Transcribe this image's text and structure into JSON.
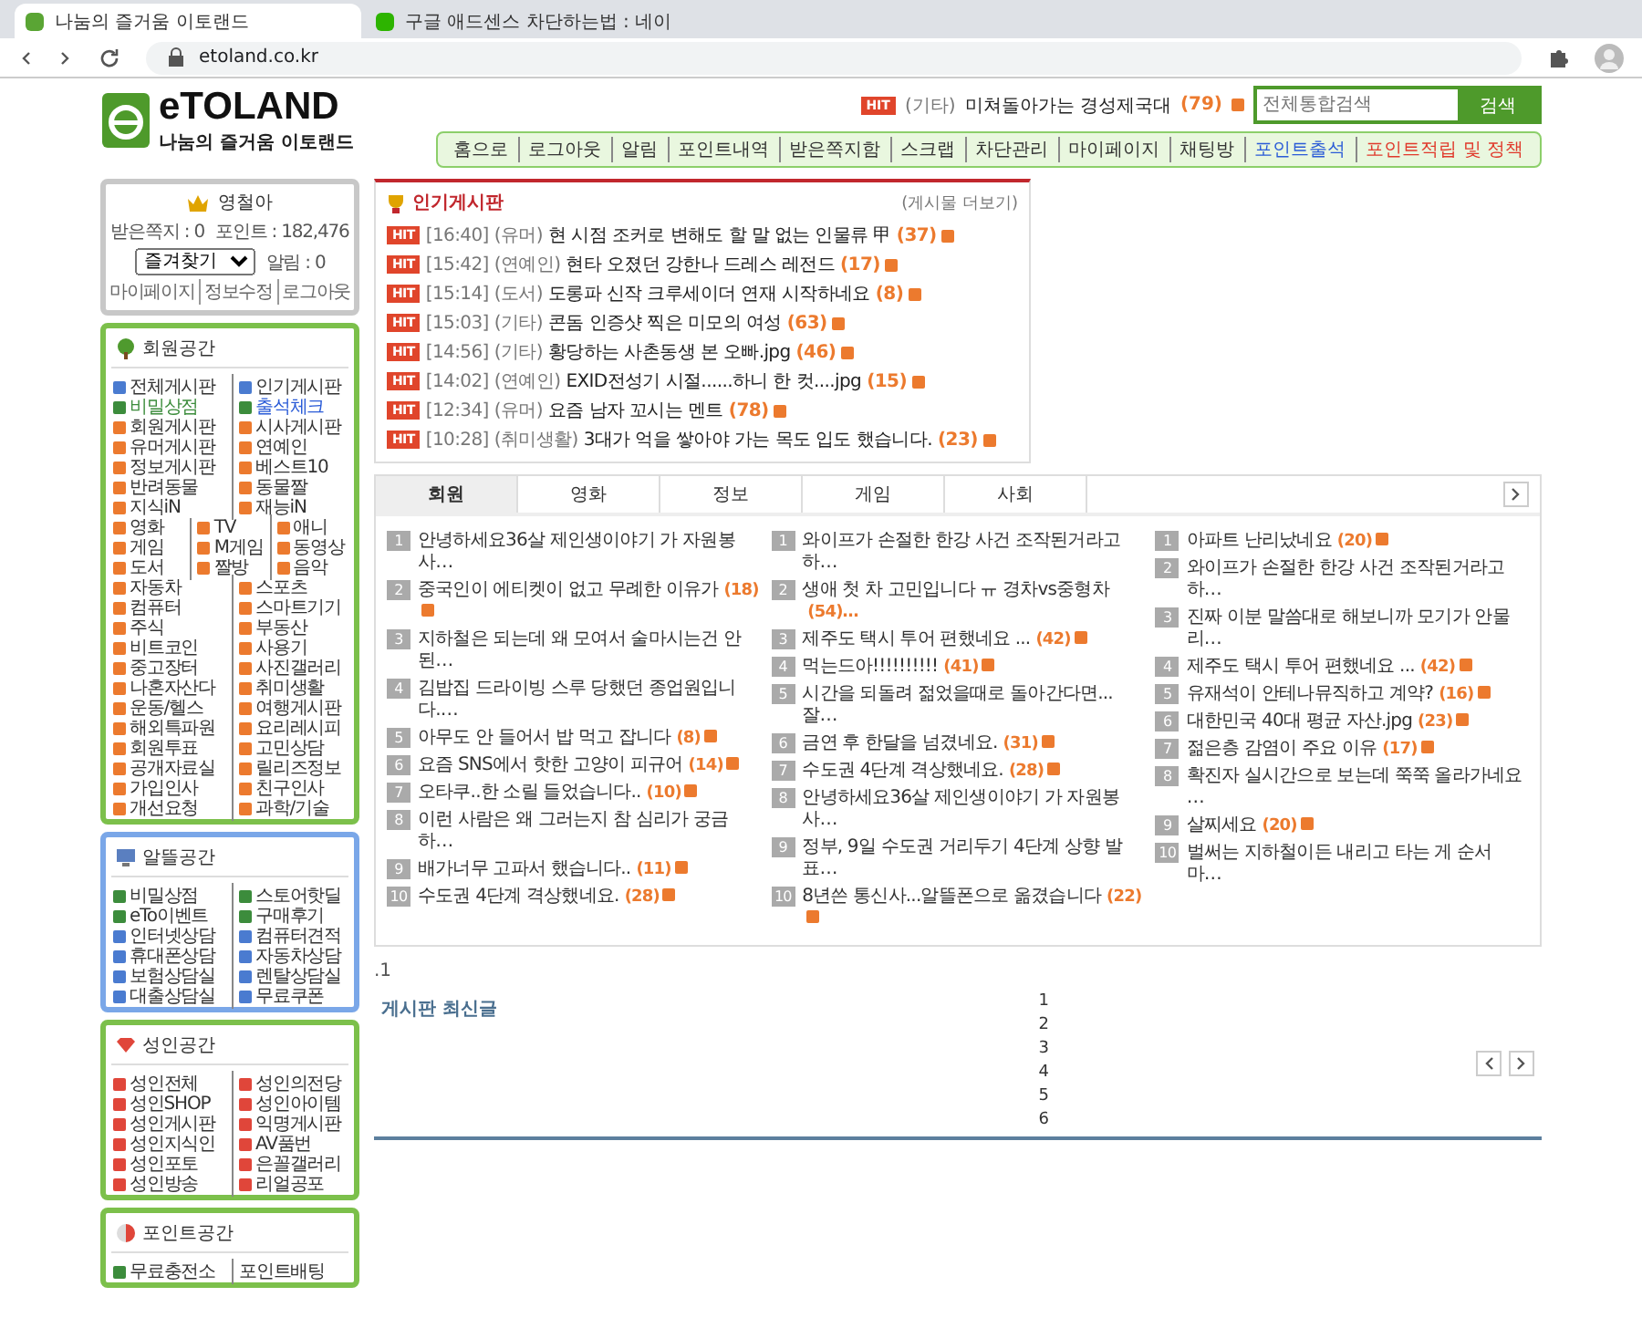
{
  "browser": {
    "tabs": [
      {
        "title": "나눔의 즐거움 이토랜드",
        "selected": true
      },
      {
        "title": "구글 애드센스 차단하는법 : 네이",
        "selected": false
      }
    ],
    "url": "etoland.co.kr"
  },
  "header": {
    "logo": {
      "name": "eTOLAND",
      "tagline": "나눔의 즐거움 이토랜드"
    },
    "ticker": {
      "badge": "HIT",
      "category": "(기타)",
      "title": "미쳐돌아가는 경성제국대",
      "count": "(79)"
    },
    "search": {
      "placeholder": "전체통합검색",
      "button": "검색"
    },
    "nav": [
      {
        "label": "홈으로",
        "color": "#333333"
      },
      {
        "label": "로그아웃",
        "color": "#333333"
      },
      {
        "label": "알림",
        "color": "#333333"
      },
      {
        "label": "포인트내역",
        "color": "#333333"
      },
      {
        "label": "받은쪽지함",
        "color": "#333333"
      },
      {
        "label": "스크랩",
        "color": "#333333"
      },
      {
        "label": "차단관리",
        "color": "#333333"
      },
      {
        "label": "마이페이지",
        "color": "#333333"
      },
      {
        "label": "채팅방",
        "color": "#333333"
      },
      {
        "label": "포인트출석",
        "color": "#2a5bd7"
      },
      {
        "label": "포인트적립 및 정책",
        "color": "#e0392b"
      }
    ]
  },
  "user_box": {
    "nickname": "영철아",
    "messages": "받은쪽지 : 0",
    "points": "포인트 : 182,476",
    "select": "즐겨찾기",
    "alarm": "알림 : 0",
    "links": [
      "마이페이지",
      "정보수정",
      "로그아웃"
    ]
  },
  "sidebar": {
    "sections": [
      {
        "title": "회원공간",
        "kind": "tree",
        "color": "#7cc04b",
        "rows": [
          [
            {
              "label": "전체게시판",
              "bullet": {
                "color": "#4a7bd0"
              }
            },
            {
              "label": "인기게시판",
              "bullet": {
                "color": "#4a7bd0"
              }
            }
          ],
          [
            {
              "label": "비밀상점",
              "color": "#3c8c3c",
              "bullet": {
                "color": "#3c8c3c"
              }
            },
            {
              "label": "출석체크",
              "color": "#2a5bd7",
              "bullet": {
                "color": "#3c8c3c"
              }
            }
          ],
          [
            {
              "label": "회원게시판",
              "bullet": {
                "color": "#ec7a2e"
              }
            },
            {
              "label": "시사게시판",
              "bullet": {
                "color": "#ec7a2e"
              }
            }
          ],
          [
            {
              "label": "유머게시판",
              "bullet": {
                "color": "#ec7a2e"
              }
            },
            {
              "label": "연예인",
              "bullet": {
                "color": "#ec7a2e"
              }
            }
          ],
          [
            {
              "label": "정보게시판",
              "bullet": {
                "color": "#ec7a2e"
              }
            },
            {
              "label": "베스트10",
              "bullet": {
                "color": "#ec7a2e"
              }
            }
          ],
          [
            {
              "label": "반려동물",
              "bullet": {
                "color": "#ec7a2e"
              }
            },
            {
              "label": "동물짤",
              "bullet": {
                "color": "#ec7a2e"
              }
            }
          ],
          [
            {
              "label": "지식iN",
              "bullet": {
                "color": "#ec7a2e"
              }
            },
            {
              "label": "재능iN",
              "bullet": {
                "color": "#ec7a2e"
              }
            }
          ],
          [
            {
              "label": "영화",
              "bullet": {
                "color": "#ec7a2e"
              }
            },
            {
              "label": "TV",
              "bullet": {
                "color": "#ec7a2e"
              }
            },
            {
              "label": "애니",
              "bullet": {
                "color": "#ec7a2e"
              }
            }
          ],
          [
            {
              "label": "게임",
              "bullet": {
                "color": "#ec7a2e"
              }
            },
            {
              "label": "M게임",
              "bullet": {
                "color": "#ec7a2e"
              }
            },
            {
              "label": "동영상",
              "bullet": {
                "color": "#ec7a2e"
              }
            }
          ],
          [
            {
              "label": "도서",
              "bullet": {
                "color": "#ec7a2e"
              }
            },
            {
              "label": "짤방",
              "bullet": {
                "color": "#ec7a2e"
              }
            },
            {
              "label": "음악",
              "bullet": {
                "color": "#ec7a2e"
              }
            }
          ],
          [
            {
              "label": "자동차",
              "bullet": {
                "color": "#ec7a2e"
              }
            },
            {
              "label": "스포츠",
              "bullet": {
                "color": "#ec7a2e"
              }
            }
          ],
          [
            {
              "label": "컴퓨터",
              "bullet": {
                "color": "#ec7a2e"
              }
            },
            {
              "label": "스마트기기",
              "bullet": {
                "color": "#ec7a2e"
              }
            }
          ],
          [
            {
              "label": "주식",
              "bullet": {
                "color": "#ec7a2e"
              }
            },
            {
              "label": "부동산",
              "bullet": {
                "color": "#ec7a2e"
              }
            }
          ],
          [
            {
              "label": "비트코인",
              "bullet": {
                "color": "#ec7a2e"
              }
            },
            {
              "label": "사용기",
              "bullet": {
                "color": "#ec7a2e"
              }
            }
          ],
          [
            {
              "label": "중고장터",
              "bullet": {
                "color": "#ec7a2e"
              }
            },
            {
              "label": "사진갤러리",
              "bullet": {
                "color": "#ec7a2e"
              }
            }
          ],
          [
            {
              "label": "나혼자산다",
              "bullet": {
                "color": "#ec7a2e"
              }
            },
            {
              "label": "취미생활",
              "bullet": {
                "color": "#ec7a2e"
              }
            }
          ],
          [
            {
              "label": "운동/헬스",
              "bullet": {
                "color": "#ec7a2e"
              }
            },
            {
              "label": "여행게시판",
              "bullet": {
                "color": "#ec7a2e"
              }
            }
          ],
          [
            {
              "label": "해외특파원",
              "bullet": {
                "color": "#ec7a2e"
              }
            },
            {
              "label": "요리레시피",
              "bullet": {
                "color": "#ec7a2e"
              }
            }
          ],
          [
            {
              "label": "회원투표",
              "bullet": {
                "color": "#ec7a2e"
              }
            },
            {
              "label": "고민상담",
              "bullet": {
                "color": "#ec7a2e"
              }
            }
          ],
          [
            {
              "label": "공개자료실",
              "bullet": {
                "color": "#ec7a2e"
              }
            },
            {
              "label": "릴리즈정보",
              "bullet": {
                "color": "#ec7a2e"
              }
            }
          ],
          [
            {
              "label": "가입인사",
              "bullet": {
                "color": "#ec7a2e"
              }
            },
            {
              "label": "친구인사",
              "bullet": {
                "color": "#ec7a2e"
              }
            }
          ],
          [
            {
              "label": "개선요청",
              "bullet": {
                "color": "#ec7a2e"
              }
            },
            {
              "label": "과학/기술",
              "bullet": {
                "color": "#ec7a2e"
              }
            }
          ]
        ]
      },
      {
        "title": "알뜰공간",
        "kind": "monitor",
        "color": "#7aa7e8",
        "rows": [
          [
            {
              "label": "비밀상점",
              "bullet": {
                "color": "#3c8c3c"
              }
            },
            {
              "label": "스토어핫딜",
              "bullet": {
                "color": "#3c8c3c"
              }
            }
          ],
          [
            {
              "label": "eTo이벤트",
              "bullet": {
                "color": "#3c8c3c"
              }
            },
            {
              "label": "구매후기",
              "bullet": {
                "color": "#3c8c3c"
              }
            }
          ],
          [
            {
              "label": "인터넷상담",
              "bullet": {
                "color": "#4a7bd0"
              }
            },
            {
              "label": "컴퓨터견적",
              "bullet": {
                "color": "#4a7bd0"
              }
            }
          ],
          [
            {
              "label": "휴대폰상담",
              "bullet": {
                "color": "#4a7bd0"
              }
            },
            {
              "label": "자동차상담",
              "bullet": {
                "color": "#4a7bd0"
              }
            }
          ],
          [
            {
              "label": "보험상담실",
              "bullet": {
                "color": "#4a7bd0"
              }
            },
            {
              "label": "렌탈상담실",
              "bullet": {
                "color": "#4a7bd0"
              }
            }
          ],
          [
            {
              "label": "대출상담실",
              "bullet": {
                "color": "#4a7bd0"
              }
            },
            {
              "label": "무료쿠폰",
              "bullet": {
                "color": "#4a7bd0"
              }
            }
          ]
        ]
      },
      {
        "title": "성인공간",
        "kind": "gem",
        "color": "#7cc04b",
        "rows": [
          [
            {
              "label": "성인전체",
              "bullet": {
                "color": "#e0463a"
              }
            },
            {
              "label": "성인의전당",
              "bullet": {
                "color": "#e0463a"
              }
            }
          ],
          [
            {
              "label": "성인SHOP",
              "bullet": {
                "color": "#e0463a"
              }
            },
            {
              "label": "성인아이템",
              "bullet": {
                "color": "#e0463a"
              }
            }
          ],
          [
            {
              "label": "성인게시판",
              "bullet": {
                "color": "#e0463a"
              }
            },
            {
              "label": "익명게시판",
              "bullet": {
                "color": "#e0463a"
              }
            }
          ],
          [
            {
              "label": "성인지식인",
              "bullet": {
                "color": "#e0463a"
              }
            },
            {
              "label": "AV품번",
              "bullet": {
                "color": "#e0463a"
              }
            }
          ],
          [
            {
              "label": "성인포토",
              "bullet": {
                "color": "#e0463a"
              }
            },
            {
              "label": "은꼴갤러리",
              "bullet": {
                "color": "#e0463a"
              }
            }
          ],
          [
            {
              "label": "성인방송",
              "bullet": {
                "color": "#e0463a"
              }
            },
            {
              "label": "리얼공포",
              "bullet": {
                "color": "#e0463a"
              }
            }
          ]
        ]
      },
      {
        "title": "포인트공간",
        "kind": "ball",
        "color": "#7cc04b",
        "rows": [
          [
            {
              "label": "무료충전소",
              "bullet": {
                "color": "#3c8c3c"
              }
            },
            {
              "label": "포인트배팅"
            }
          ]
        ]
      }
    ]
  },
  "popular": {
    "title": "인기게시판",
    "more": "(게시물 더보기)",
    "items": [
      {
        "badge": "HIT",
        "time": "[16:40]",
        "category": "(유머)",
        "title": "현 시점 조커로 변해도 할 말 없는 인물류 甲",
        "count": "(37)"
      },
      {
        "badge": "HIT",
        "time": "[15:42]",
        "category": "(연예인)",
        "title": "현타 오졌던 강한나 드레스 레전드",
        "count": "(17)"
      },
      {
        "badge": "HIT",
        "time": "[15:14]",
        "category": "(도서)",
        "title": "도롱파 신작 크루세이더 연재 시작하네요",
        "count": "(8)"
      },
      {
        "badge": "HIT",
        "time": "[15:03]",
        "category": "(기타)",
        "title": "콘돔 인증샷 찍은 미모의 여성",
        "count": "(63)"
      },
      {
        "badge": "HIT",
        "time": "[14:56]",
        "category": "(기타)",
        "title": "황당하는 사촌동생 본 오빠.jpg",
        "count": "(46)"
      },
      {
        "badge": "HIT",
        "time": "[14:02]",
        "category": "(연예인)",
        "title": "EXID전성기 시절......하니 한 컷....jpg",
        "count": "(15)"
      },
      {
        "badge": "HIT",
        "time": "[12:34]",
        "category": "(유머)",
        "title": "요즘 남자 꼬시는 멘트",
        "count": "(78)"
      },
      {
        "badge": "HIT",
        "time": "[10:28]",
        "category": "(취미생활)",
        "title": "3대가 억을 쌓아야 가는 목도 입도 했습니다.",
        "count": "(23)"
      }
    ]
  },
  "best": {
    "tabs": [
      {
        "label": "회원",
        "selected": true
      },
      {
        "label": "영화",
        "selected": false
      },
      {
        "label": "정보",
        "selected": false
      },
      {
        "label": "게임",
        "selected": false
      },
      {
        "label": "사회",
        "selected": false
      }
    ],
    "columns": [
      [
        {
          "rank": "1",
          "title": "안녕하세요36살 제인생이야기 가 자원봉사…"
        },
        {
          "rank": "2",
          "title": "중국인이 에티켓이 없고 무례한 이유가",
          "count": "(18)",
          "icon": true
        },
        {
          "rank": "3",
          "title": "지하철은 되는데 왜 모여서 술마시는건 안된…"
        },
        {
          "rank": "4",
          "title": "김밥집 드라이빙 스루 당했던 종업원입니다.…"
        },
        {
          "rank": "5",
          "title": "아무도 안 들어서 밥 먹고 잡니다",
          "count": "(8)",
          "icon": true
        },
        {
          "rank": "6",
          "title": "요즘 SNS에서 핫한 고양이 피규어",
          "count": "(14)",
          "icon": true
        },
        {
          "rank": "7",
          "title": "오타쿠..한 소릴 들었습니다..",
          "count": "(10)",
          "icon": true
        },
        {
          "rank": "8",
          "title": "이런 사람은 왜 그러는지 참 심리가 궁금하…"
        },
        {
          "rank": "9",
          "title": "배가너무 고파서 했습니다..",
          "count": "(11)",
          "icon": true
        },
        {
          "rank": "10",
          "title": "수도권 4단계 격상했네요.",
          "count": "(28)",
          "icon": true
        }
      ],
      [
        {
          "rank": "1",
          "title": "와이프가 손절한 한강 사건 조작된거라고 하…"
        },
        {
          "rank": "2",
          "title": "생애 첫 차 고민입니다 ㅠ 경차vs중형차",
          "count": "(54)…",
          "icon": false
        },
        {
          "rank": "3",
          "title": "제주도 택시 투어 편했네요 ...",
          "count": "(42)",
          "icon": true
        },
        {
          "rank": "4",
          "title": "먹는드아!!!!!!!!!!",
          "count": "(41)",
          "icon": true
        },
        {
          "rank": "5",
          "title": "시간을 되돌려 젊었을때로 돌아간다면...잘…"
        },
        {
          "rank": "6",
          "title": "금연 후 한달을 넘겼네요.",
          "count": "(31)",
          "icon": true
        },
        {
          "rank": "7",
          "title": "수도권 4단계 격상했네요.",
          "count": "(28)",
          "icon": true
        },
        {
          "rank": "8",
          "title": "안녕하세요36살 제인생이야기 가 자원봉사…"
        },
        {
          "rank": "9",
          "title": "정부, 9일 수도권 거리두기 4단계 상향 발표…"
        },
        {
          "rank": "10",
          "title": "8년쓴 통신사...알뜰폰으로 옮겼습니다",
          "count": "(22)",
          "icon": true
        }
      ],
      [
        {
          "rank": "1",
          "title": "아파트 난리났네요",
          "count": "(20)",
          "icon": true
        },
        {
          "rank": "2",
          "title": "와이프가 손절한 한강 사건 조작된거라고 하…"
        },
        {
          "rank": "3",
          "title": "진짜 이분 말씀대로 해보니까 모기가 안물리…"
        },
        {
          "rank": "4",
          "title": "제주도 택시 투어 편했네요 ...",
          "count": "(42)",
          "icon": true
        },
        {
          "rank": "5",
          "title": "유재석이 안테나뮤직하고 계약?",
          "count": "(16)",
          "icon": true
        },
        {
          "rank": "6",
          "title": "대한민국 40대 평균 자산.jpg",
          "count": "(23)",
          "icon": true
        },
        {
          "rank": "7",
          "title": "젊은층 감염이 주요 이유",
          "count": "(17)",
          "icon": true
        },
        {
          "rank": "8",
          "title": "확진자 실시간으로 보는데 쭉쭉 올라가네요 …"
        },
        {
          "rank": "9",
          "title": "살찌세요",
          "count": "(20)",
          "icon": true
        },
        {
          "rank": "10",
          "title": "벌써는 지하철이든 내리고 타는 게 순서 마…"
        }
      ]
    ]
  },
  "stray_text": ".1",
  "latest": {
    "title": "게시판 최신글",
    "pages": [
      "1",
      "2",
      "3",
      "4",
      "5",
      "6"
    ]
  }
}
